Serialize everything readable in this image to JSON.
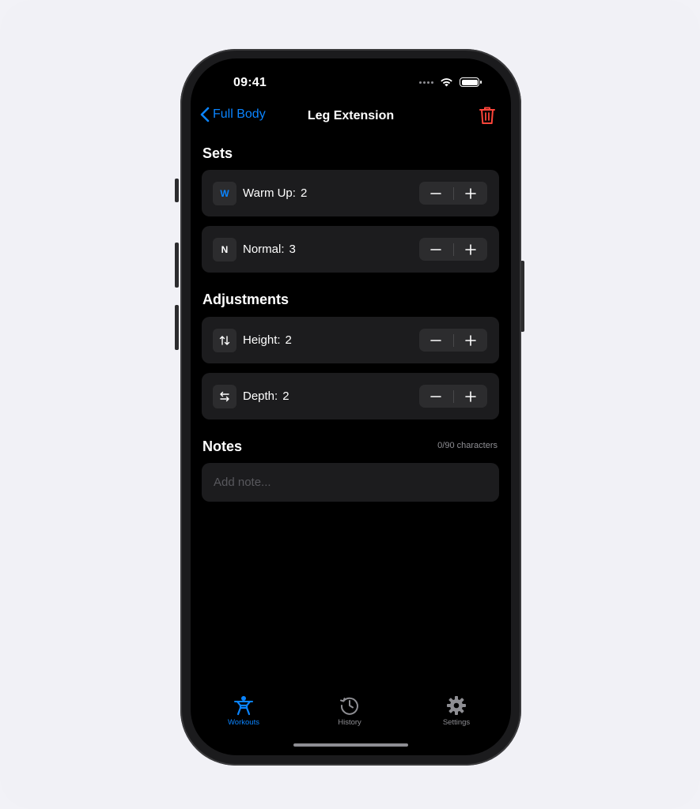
{
  "status_bar": {
    "time": "09:41"
  },
  "nav": {
    "back_label": "Full Body",
    "title": "Leg Extension"
  },
  "sets": {
    "title": "Sets",
    "rows": [
      {
        "badge": "W",
        "label": "Warm Up:",
        "value": "2",
        "badge_color": "#0a84ff"
      },
      {
        "badge": "N",
        "label": "Normal:",
        "value": "3",
        "badge_color": "#ffffff"
      }
    ]
  },
  "adjustments": {
    "title": "Adjustments",
    "rows": [
      {
        "icon": "arrows-up-down-icon",
        "label": "Height:",
        "value": "2"
      },
      {
        "icon": "arrows-left-right-icon",
        "label": "Depth:",
        "value": "2"
      }
    ]
  },
  "notes": {
    "title": "Notes",
    "count": "0/90 characters",
    "placeholder": "Add note..."
  },
  "tabs": [
    {
      "label": "Workouts",
      "icon": "workout-figure-icon",
      "active": true
    },
    {
      "label": "History",
      "icon": "history-clock-icon",
      "active": false
    },
    {
      "label": "Settings",
      "icon": "gear-icon",
      "active": false
    }
  ],
  "colors": {
    "accent": "#0a84ff",
    "destructive": "#ff453a",
    "background": "#000000",
    "row": "#1c1c1e"
  }
}
